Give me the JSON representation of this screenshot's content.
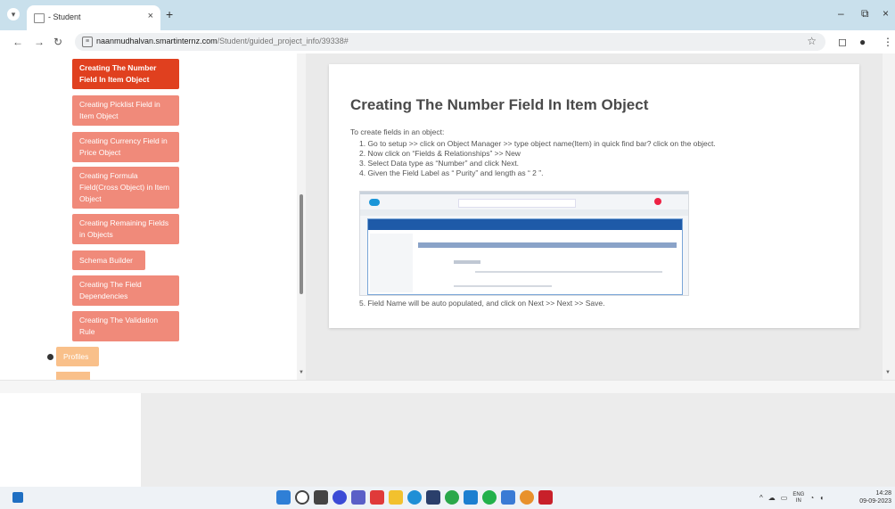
{
  "browser": {
    "tab_title": "- Student",
    "tab_close": "×",
    "new_tab": "+",
    "url_host": "naanmudhalvan.smartinternz.com",
    "url_path": "/Student/guided_project_info/39338#",
    "window_minimize": "–",
    "window_restore": "⧉",
    "window_close": "×"
  },
  "sidebar": {
    "steps": [
      {
        "label": "Creating The Number Field In Item Object",
        "active": true
      },
      {
        "label": "Creating Picklist Field in Item Object",
        "active": false
      },
      {
        "label": "Creating Currency Field in Price Object",
        "active": false
      },
      {
        "label": "Creating Formula Field(Cross Object) in Item Object",
        "active": false
      },
      {
        "label": "Creating Remaining Fields in Objects",
        "active": false
      },
      {
        "label": "Schema Builder",
        "active": false
      },
      {
        "label": "Creating The Field Dependencies",
        "active": false
      },
      {
        "label": "Creating The Validation Rule",
        "active": false
      }
    ],
    "profiles_label": "Profiles"
  },
  "content": {
    "title": "Creating The Number Field In Item Object",
    "intro": "To create fields in an object:",
    "steps": [
      "1. Go to setup >> click on Object Manager >> type object name(Item) in quick find bar? click on the object.",
      "2. Now click on “Fields & Relationships” >> New",
      "3. Select Data type as “Number” and click Next.",
      "4. Given the Field Label as “ Purity” and length as “ 2 ”."
    ],
    "last_step": "5. Field Name will be auto populated, and click on Next >> Next >> Save."
  },
  "taskbar": {
    "language": "ENG",
    "region": "IN",
    "time": "14:28",
    "date": "09-09-2023"
  },
  "colors": {
    "active_step": "#e0401f",
    "inactive_step": "#f08a7a",
    "profiles": "#f9c08a",
    "tab_strip": "#c9e0ec"
  }
}
